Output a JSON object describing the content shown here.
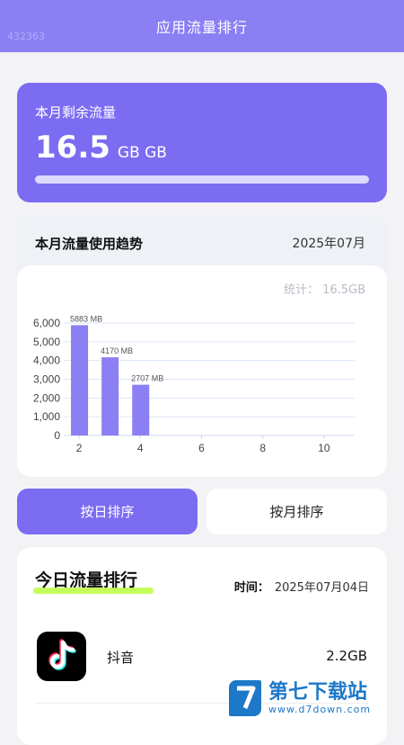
{
  "header": {
    "title": "应用流量排行",
    "watermark_id": "432363"
  },
  "remaining": {
    "label": "本月剩余流量",
    "value": "16.5",
    "unit": "GB GB",
    "bar_fill_fraction": 1.0
  },
  "trend": {
    "title": "本月流量使用趋势",
    "month": "2025年07月",
    "total_label": "统计：",
    "total_value": "16.5GB"
  },
  "chart_data": {
    "type": "bar",
    "x": [
      2,
      3,
      4
    ],
    "values": [
      5883,
      4170,
      2707
    ],
    "data_labels": [
      "5883 MB",
      "4170 MB",
      "2707 MB"
    ],
    "x_ticks": [
      "2",
      "4",
      "6",
      "8",
      "10"
    ],
    "y_ticks": [
      "0",
      "1,000",
      "2,000",
      "3,000",
      "4,000",
      "5,000",
      "6,000"
    ],
    "xlim": [
      1.5,
      11
    ],
    "ylim": [
      0,
      6000
    ],
    "grid": true,
    "bar_color": "#8b7ff3"
  },
  "sort": {
    "day_label": "按日排序",
    "month_label": "按月排序"
  },
  "ranking": {
    "title": "今日流量排行",
    "time_label": "时间：",
    "time_value": "2025年07月04日",
    "apps": [
      {
        "name": "抖音",
        "usage": "2.2GB",
        "icon": "tiktok-icon"
      }
    ]
  },
  "site_watermark": {
    "name": "第七下载站",
    "domain": "www.d7down.com"
  },
  "colors": {
    "accent": "#7c6cf2",
    "header": "#8b7ff3",
    "highlight": "#c5ff5c"
  }
}
